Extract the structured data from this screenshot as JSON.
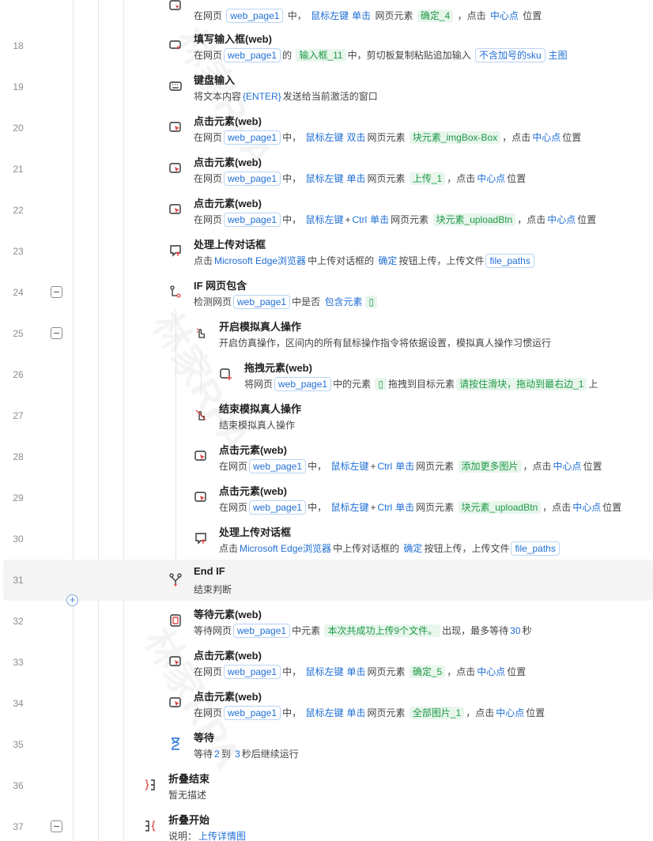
{
  "watermark": "林家RPA",
  "top_partial": {
    "desc_pre": "在网页",
    "tag": "web_page1",
    "mid": "中，",
    "kw1": "鼠标左键",
    "kw2": "单击",
    "txt": "网页元素",
    "val": "确定_4",
    "txt2": "，点击",
    "kw3": "中心点",
    "txt3": "位置"
  },
  "rows": [
    {
      "num": "18",
      "title": "填写输入框(web)"
    },
    {
      "num": "19",
      "title": "键盘输入"
    },
    {
      "num": "20",
      "title": "点击元素(web)"
    },
    {
      "num": "21",
      "title": "点击元素(web)"
    },
    {
      "num": "22",
      "title": "点击元素(web)"
    },
    {
      "num": "23",
      "title": "处理上传对话框"
    },
    {
      "num": "24",
      "title": "IF 网页包含"
    },
    {
      "num": "25",
      "title": "开启模拟真人操作"
    },
    {
      "num": "26",
      "title": "拖拽元素(web)"
    },
    {
      "num": "27",
      "title": "结束模拟真人操作"
    },
    {
      "num": "28",
      "title": "点击元素(web)"
    },
    {
      "num": "29",
      "title": "点击元素(web)"
    },
    {
      "num": "30",
      "title": "处理上传对话框"
    },
    {
      "num": "31",
      "title": "End IF"
    },
    {
      "num": "32",
      "title": "等待元素(web)"
    },
    {
      "num": "33",
      "title": "点击元素(web)"
    },
    {
      "num": "34",
      "title": "点击元素(web)"
    },
    {
      "num": "35",
      "title": "等待"
    },
    {
      "num": "36",
      "title": "折叠结束"
    },
    {
      "num": "37",
      "title": "折叠开始"
    }
  ],
  "d18": {
    "a": "在网页",
    "tag": "web_page1",
    "b": "的",
    "val": "输入框_11",
    "c": "中，剪切板复制粘贴追加输入",
    "tag2": "不含加号的sku",
    "kw": "主图"
  },
  "d19": {
    "a": "将文本内容",
    "kw": "{ENTER}",
    "b": "发送给当前激活的窗口"
  },
  "d20": {
    "a": "在网页",
    "tag": "web_page1",
    "b": "中，",
    "k1": "鼠标左键",
    "k2": "双击",
    "c": "网页元素",
    "val": "块元素_imgBox-Box",
    "d": "，点击",
    "k3": "中心点",
    "e": "位置"
  },
  "d21": {
    "a": "在网页",
    "tag": "web_page1",
    "b": "中，",
    "k1": "鼠标左键",
    "k2": "单击",
    "c": "网页元素",
    "val": "上传_1",
    "d": "，点击",
    "k3": "中心点",
    "e": "位置"
  },
  "d22": {
    "a": "在网页",
    "tag": "web_page1",
    "b": "中，",
    "k1": "鼠标左键",
    "plus": "+",
    "k4": "Ctrl",
    "k2": "单击",
    "c": "网页元素",
    "val": "块元素_uploadBtn",
    "d": "，点击",
    "k3": "中心点",
    "e": "位置"
  },
  "d23": {
    "a": "点击",
    "kw": "Microsoft Edge浏览器",
    "b": "中上传对话框的",
    "kw2": "确定",
    "c": "按钮上传，上传文件",
    "tag": "file_paths"
  },
  "d24": {
    "a": "检测网页",
    "tag": "web_page1",
    "b": "中是否",
    "kw": "包含元素",
    "val": "▯"
  },
  "d25": {
    "a": "开启仿真操作，区间内的所有鼠标操作指令将依据设置，模拟真人操作习惯运行"
  },
  "d26": {
    "a": "将网页",
    "tag": "web_page1",
    "b": "中的元素",
    "val": "▯",
    "c": "拖拽到目标元素",
    "val2": "请按住滑块，拖动到最右边_1",
    "d": "上"
  },
  "d27": {
    "a": "结束模拟真人操作"
  },
  "d28": {
    "a": "在网页",
    "tag": "web_page1",
    "b": "中，",
    "k1": "鼠标左键",
    "plus": "+",
    "k4": "Ctrl",
    "k2": "单击",
    "c": "网页元素",
    "val": "添加更多图片",
    "d": "，点击",
    "k3": "中心点",
    "e": "位置"
  },
  "d29": {
    "a": "在网页",
    "tag": "web_page1",
    "b": "中，",
    "k1": "鼠标左键",
    "plus": "+",
    "k4": "Ctrl",
    "k2": "单击",
    "c": "网页元素",
    "val": "块元素_uploadBtn",
    "d": "，点击",
    "k3": "中心点",
    "e": "位置"
  },
  "d30": {
    "a": "点击",
    "kw": "Microsoft Edge浏览器",
    "b": "中上传对话框的",
    "kw2": "确定",
    "c": "按钮上传，上传文件",
    "tag": "file_paths"
  },
  "d31": {
    "a": "结束判断"
  },
  "d32": {
    "a": "等待网页",
    "tag": "web_page1",
    "b": "中元素",
    "val": "本次共成功上传9个文件。",
    "c": "出现，最多等待",
    "kw": "30",
    "d": "秒"
  },
  "d33": {
    "a": "在网页",
    "tag": "web_page1",
    "b": "中，",
    "k1": "鼠标左键",
    "k2": "单击",
    "c": "网页元素",
    "val": "确定_5",
    "d": "，点击",
    "k3": "中心点",
    "e": "位置"
  },
  "d34": {
    "a": "在网页",
    "tag": "web_page1",
    "b": "中，",
    "k1": "鼠标左键",
    "k2": "单击",
    "c": "网页元素",
    "val": "全部图片_1",
    "d": "，点击",
    "k3": "中心点",
    "e": "位置"
  },
  "d35": {
    "a": "等待",
    "k1": "2",
    "b": "到",
    "k2": "3",
    "c": "秒后继续运行"
  },
  "d36": {
    "a": "暂无描述"
  },
  "d37": {
    "a": "说明：",
    "kw": "上传详情图"
  },
  "add_button": "+"
}
